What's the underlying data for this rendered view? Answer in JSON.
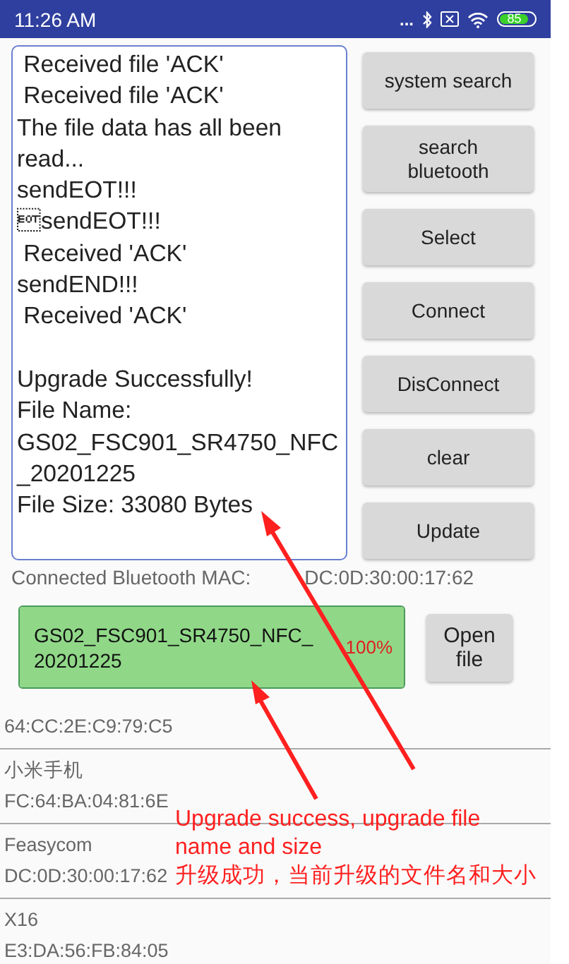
{
  "status_bar": {
    "time": "11:26 AM",
    "dots": "...",
    "battery": "85"
  },
  "log": {
    "groups": [
      [
        " Received file 'ACK'",
        " Received file 'ACK'",
        "The file data has all been read...",
        "sendEOT!!!",
        "\u0004sendEOT!!!",
        " Received 'ACK'",
        "sendEND!!!",
        " Received 'ACK'"
      ],
      [
        "Upgrade Successfully!",
        "File Name: GS02_FSC901_SR4750_NFC_20201225",
        "File Size: 33080 Bytes"
      ]
    ]
  },
  "buttons": [
    "system search",
    "search bluetooth",
    "Select",
    "Connect",
    "DisConnect",
    "clear",
    "Update"
  ],
  "connected": {
    "label": "Connected Bluetooth MAC:",
    "mac": "DC:0D:30:00:17:62"
  },
  "progress": {
    "file": "GS02_FSC901_SR4750_NFC_20201225",
    "level": 1,
    "percent": "100%"
  },
  "open_file_button": "Open file",
  "devices": [
    {
      "address": "64:CC:2E:C9:79:C5"
    },
    {
      "name": "小米手机",
      "address": "FC:64:BA:04:81:6E"
    },
    {
      "name": "Feasycom",
      "address": "DC:0D:30:00:17:62"
    },
    {
      "name": "X16",
      "address": "E3:DA:56:FB:84:05"
    }
  ],
  "annotation": {
    "english": "Upgrade success, upgrade file name and size",
    "chinese": "升级成功，当前升级的文件名和大小"
  }
}
